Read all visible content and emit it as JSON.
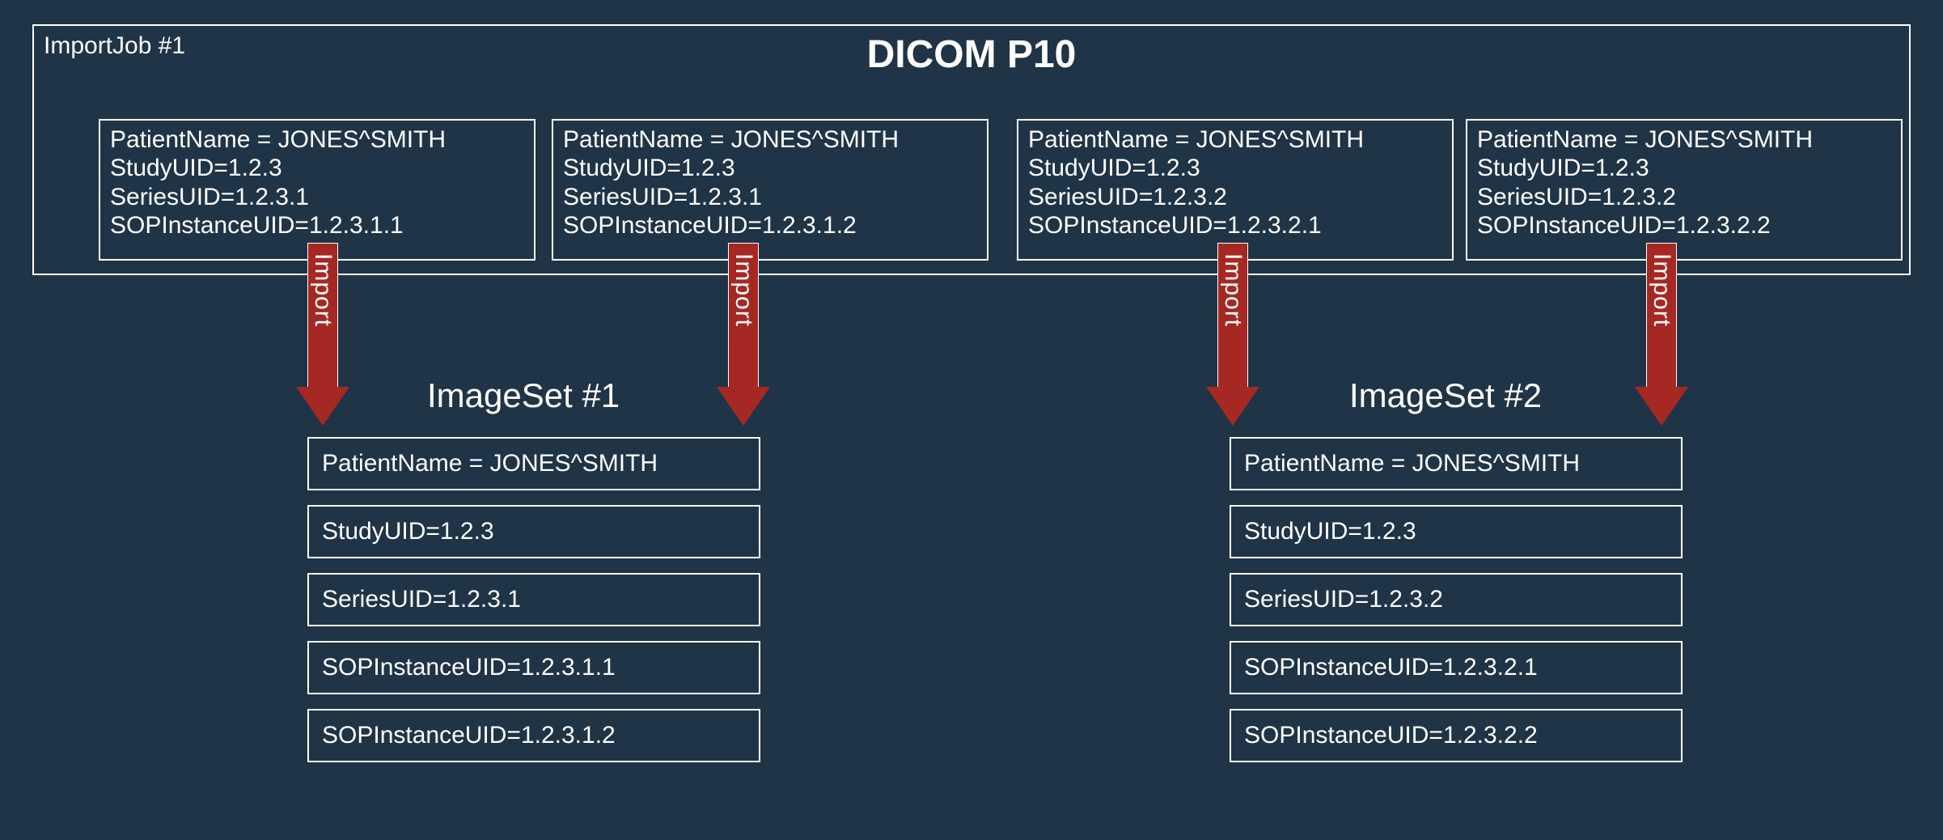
{
  "importJob": {
    "label": "ImportJob #1",
    "title": "DICOM P10",
    "boxes": [
      {
        "patientName": "PatientName = JONES^SMITH",
        "studyUID": "StudyUID=1.2.3",
        "seriesUID": "SeriesUID=1.2.3.1",
        "sopInstanceUID": "SOPInstanceUID=1.2.3.1.1"
      },
      {
        "patientName": "PatientName = JONES^SMITH",
        "studyUID": "StudyUID=1.2.3",
        "seriesUID": "SeriesUID=1.2.3.1",
        "sopInstanceUID": "SOPInstanceUID=1.2.3.1.2"
      },
      {
        "patientName": "PatientName = JONES^SMITH",
        "studyUID": "StudyUID=1.2.3",
        "seriesUID": "SeriesUID=1.2.3.2",
        "sopInstanceUID": "SOPInstanceUID=1.2.3.2.1"
      },
      {
        "patientName": "PatientName = JONES^SMITH",
        "studyUID": "StudyUID=1.2.3",
        "seriesUID": "SeriesUID=1.2.3.2",
        "sopInstanceUID": "SOPInstanceUID=1.2.3.2.2"
      }
    ]
  },
  "arrows": {
    "label": "Import"
  },
  "imageSets": [
    {
      "title": "ImageSet #1",
      "rows": [
        "PatientName = JONES^SMITH",
        "StudyUID=1.2.3",
        "SeriesUID=1.2.3.1",
        "SOPInstanceUID=1.2.3.1.1",
        "SOPInstanceUID=1.2.3.1.2"
      ]
    },
    {
      "title": "ImageSet #2",
      "rows": [
        "PatientName = JONES^SMITH",
        "StudyUID=1.2.3",
        "SeriesUID=1.2.3.2",
        "SOPInstanceUID=1.2.3.2.1",
        "SOPInstanceUID=1.2.3.2.2"
      ]
    }
  ]
}
